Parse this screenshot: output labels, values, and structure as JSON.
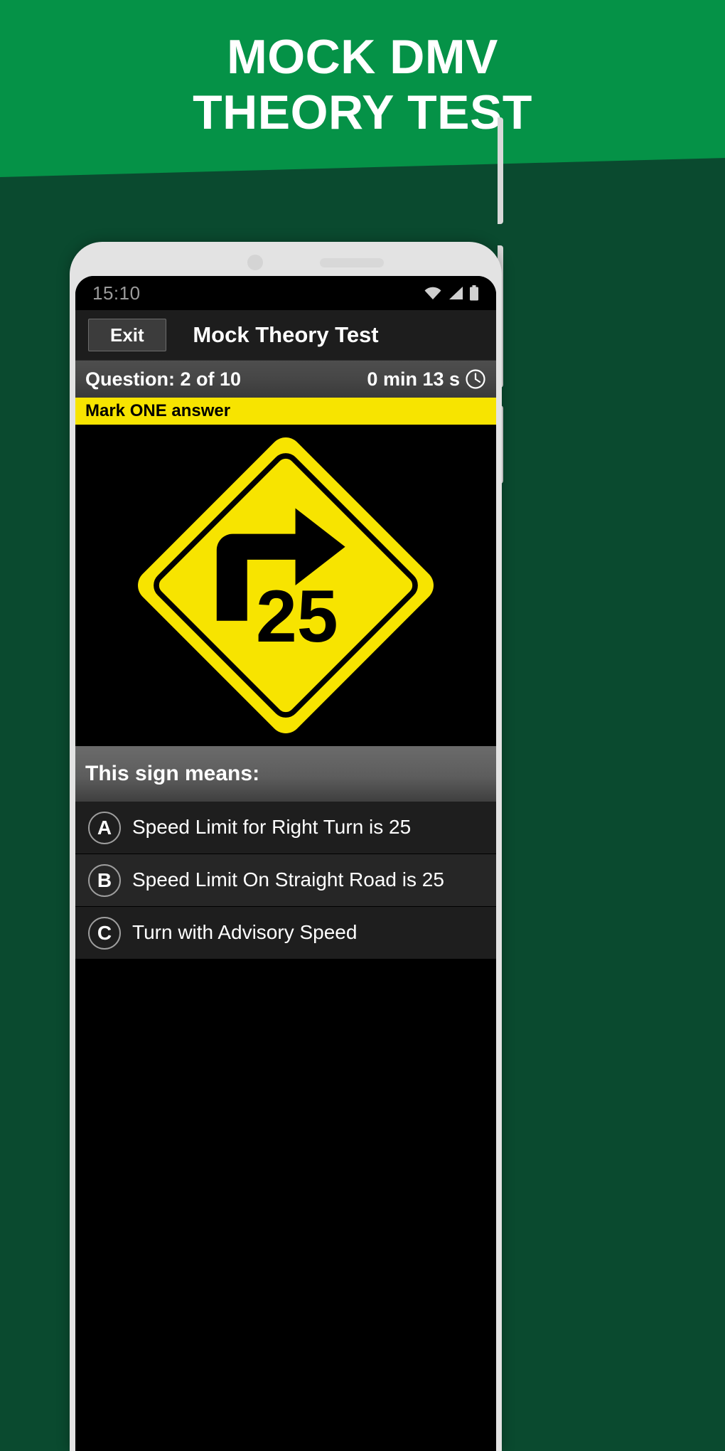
{
  "hero": {
    "line1": "MOCK DMV",
    "line2": "THEORY TEST",
    "bg_color": "#059247",
    "text_color": "#ffffff"
  },
  "page": {
    "bg_color": "#0a4a2f"
  },
  "phone": {
    "status_bar": {
      "time": "15:10",
      "icons": [
        "wifi-icon",
        "signal-icon",
        "battery-icon"
      ]
    },
    "app_header": {
      "exit_label": "Exit",
      "title": "Mock Theory Test"
    },
    "question_bar": {
      "counter": "Question: 2 of 10",
      "timer": "0 min 13 s",
      "timer_icon": "clock-icon"
    },
    "mark_strip": {
      "label": "Mark ONE answer",
      "bg_color": "#f7e400"
    },
    "sign": {
      "type": "right-turn-advisory-speed-sign",
      "shape": "diamond",
      "fill_color": "#f7e400",
      "symbol_color": "#000000",
      "speed_value": "25"
    },
    "prompt": {
      "text": "This sign means:"
    },
    "answers": [
      {
        "badge": "A",
        "text": "Speed Limit for Right Turn is 25"
      },
      {
        "badge": "B",
        "text": "Speed Limit On Straight Road is 25"
      },
      {
        "badge": "C",
        "text": "Turn with Advisory Speed"
      }
    ]
  }
}
